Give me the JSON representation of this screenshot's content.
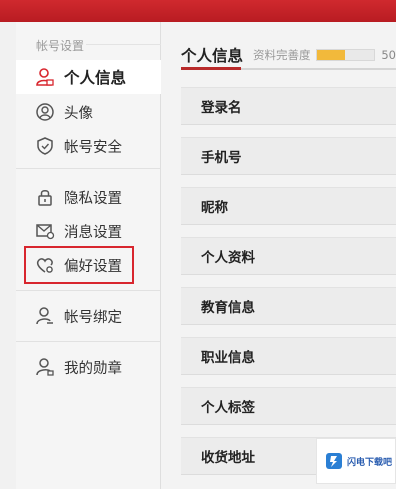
{
  "sidebar": {
    "title": "帐号设置",
    "items": [
      {
        "label": "个人信息",
        "icon": "user-icon"
      },
      {
        "label": "头像",
        "icon": "avatar-icon"
      },
      {
        "label": "帐号安全",
        "icon": "shield-icon"
      },
      {
        "label": "隐私设置",
        "icon": "lock-icon"
      },
      {
        "label": "消息设置",
        "icon": "message-icon"
      },
      {
        "label": "偏好设置",
        "icon": "heart-gear-icon"
      },
      {
        "label": "帐号绑定",
        "icon": "user-link-icon"
      },
      {
        "label": "我的勋章",
        "icon": "user-medal-icon"
      }
    ],
    "active_index": 0,
    "highlighted_index": 5
  },
  "main": {
    "title": "个人信息",
    "progress_label": "资料完善度",
    "progress_value": "50",
    "progress_fraction": 0.5,
    "fields": [
      {
        "label": "登录名"
      },
      {
        "label": "手机号"
      },
      {
        "label": "昵称"
      },
      {
        "label": "个人资料"
      },
      {
        "label": "教育信息"
      },
      {
        "label": "职业信息"
      },
      {
        "label": "个人标签"
      },
      {
        "label": "收货地址"
      }
    ]
  },
  "watermark": {
    "text": "闪电下载吧"
  },
  "colors": {
    "accent_red": "#d8262e",
    "progress": "#f2b93b",
    "topbar": "#c4242a"
  }
}
